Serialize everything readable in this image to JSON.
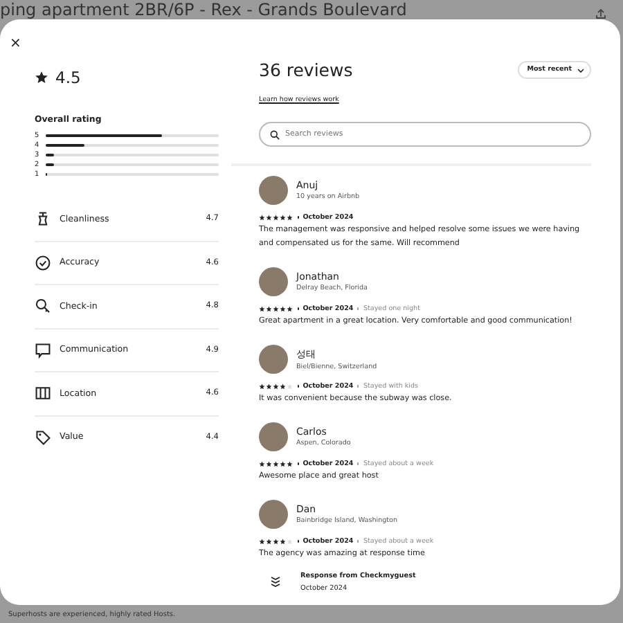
{
  "page_title": "ping apartment 2BR/6P - Rex - Grands Boulevard",
  "modal": {
    "close": "×",
    "summary": {
      "rating": "4.5",
      "overall_label": "Overall rating",
      "distribution": [
        {
          "label": "5",
          "level": 0.67
        },
        {
          "label": "4",
          "level": 0.22
        },
        {
          "label": "3",
          "level": 0.05
        },
        {
          "label": "2",
          "level": 0.05
        },
        {
          "label": "1",
          "level": 0.01
        }
      ],
      "categories": [
        {
          "kind": "cleanliness",
          "label": "Cleanliness",
          "score": "4.7"
        },
        {
          "kind": "accuracy",
          "label": "Accuracy",
          "score": "4.6"
        },
        {
          "kind": "checkin",
          "label": "Check-in",
          "score": "4.8"
        },
        {
          "kind": "communication",
          "label": "Communication",
          "score": "4.9"
        },
        {
          "kind": "location",
          "label": "Location",
          "score": "4.6"
        },
        {
          "kind": "value",
          "label": "Value",
          "score": "4.4"
        }
      ]
    },
    "reviews_header": {
      "title": "36 reviews",
      "link": "Learn how reviews work",
      "sort": "Most recent",
      "search_placeholder": "Search reviews"
    },
    "reviews": [
      {
        "name": "Anuj",
        "subtitle": "10 years on Airbnb",
        "stars": 5,
        "date": "October 2024",
        "text": "The management was responsive and helped resolve some issues we were having and compensated us for the same. Will recommend"
      },
      {
        "name": "Jonathan",
        "subtitle": "Delray Beach, Florida",
        "stars": 5,
        "date": "October 2024",
        "stay": "Stayed one night",
        "text": "Great apartment in a great location. Very comfortable and good communication!"
      },
      {
        "name": "성태",
        "subtitle": "Biel/Bienne, Switzerland",
        "stars": 4,
        "date": "October 2024",
        "stay": "Stayed with kids",
        "text": "It was convenient because the subway was close."
      },
      {
        "name": "Carlos",
        "subtitle": "Aspen, Colorado",
        "stars": 5,
        "date": "October 2024",
        "stay": "Stayed about a week",
        "text": "Awesome place and great host"
      },
      {
        "name": "Dan",
        "subtitle": "Bainbridge Island, Washington",
        "stars": 4,
        "date": "October 2024",
        "stay": "Stayed about a week",
        "text": "The agency was amazing at response time",
        "response": {
          "title": "Response from Checkmyguest",
          "date": "October 2024"
        }
      }
    ]
  },
  "footer_text": "Superhosts are experienced, highly rated Hosts."
}
